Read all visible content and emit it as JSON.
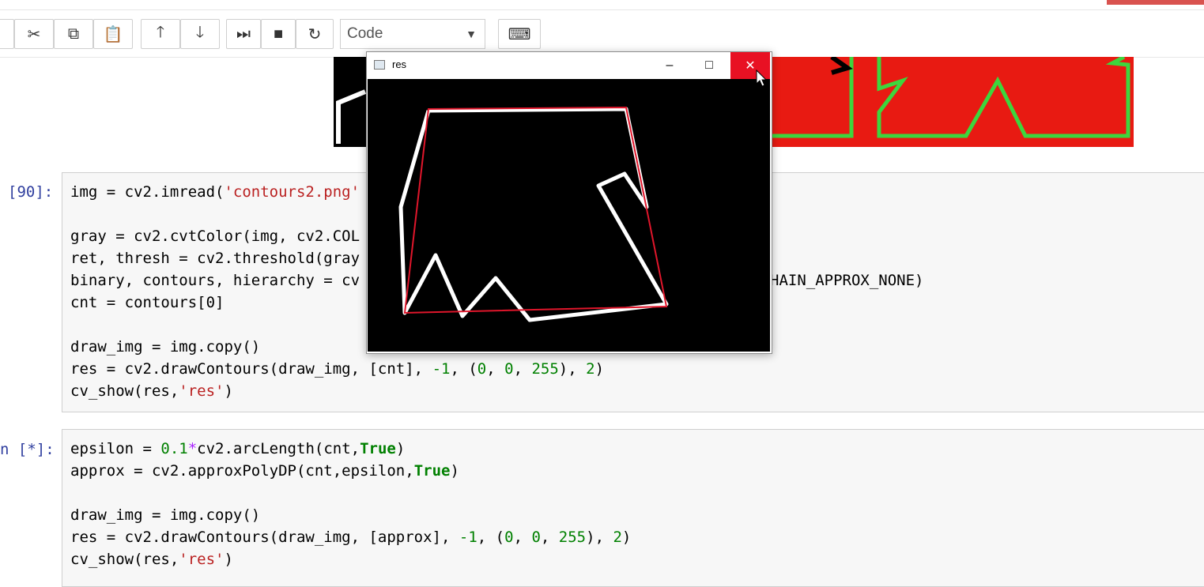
{
  "toolbar": {
    "buttons": [
      {
        "name": "cut-icon",
        "glyph": "✂"
      },
      {
        "name": "copy-icon",
        "glyph": "⧉"
      },
      {
        "name": "paste-icon",
        "glyph": "📋"
      },
      {
        "name": "move-up-icon",
        "glyph": "🡑"
      },
      {
        "name": "move-down-icon",
        "glyph": "🡓"
      },
      {
        "name": "run-icon",
        "glyph": "⏭"
      },
      {
        "name": "stop-icon",
        "glyph": "■"
      },
      {
        "name": "restart-icon",
        "glyph": "↻"
      },
      {
        "name": "keyboard-icon",
        "glyph": "⌨"
      }
    ],
    "cell_type": "Code"
  },
  "cells": [
    {
      "prompt": "[90]:"
    },
    {
      "prompt": "n [*]:"
    }
  ],
  "window": {
    "title": "res",
    "minimize": "–",
    "maximize": "□",
    "close": "✕"
  },
  "colors": {
    "contour_red": "#e0162b",
    "accent_close": "#e81123",
    "prompt": "#303f9f",
    "string": "#ba2121",
    "number": "#008000"
  },
  "code": {
    "c1_l1_a": "img = cv2.imread(",
    "c1_l1_s": "'contours2.png'",
    "c1_l2": "gray = cv2.cvtColor(img, cv2.COL",
    "c1_l3": "ret, thresh = cv2.threshold(gray",
    "c1_l4_a": "binary, contours, hierarchy = cv",
    "c1_l4_b": "HAIN_APPROX_NONE)",
    "c1_l5": "cnt = contours[0]",
    "c1_l6": "draw_img = img.copy()",
    "c1_l7_a": "res = cv2.drawContours(draw_img, [cnt], ",
    "c1_l7_b": "-1",
    "c1_l7_c": ", (",
    "c1_l7_d": "0",
    "c1_l7_e": ", ",
    "c1_l7_f": "0",
    "c1_l7_g": ", ",
    "c1_l7_h": "255",
    "c1_l7_i": "), ",
    "c1_l7_j": "2",
    "c1_l7_k": ")",
    "c1_l8_a": "cv_show(res,",
    "c1_l8_s": "'res'",
    "c1_l8_b": ")",
    "c2_l1_a": "epsilon = ",
    "c2_l1_n": "0.1",
    "c2_l1_o": "*",
    "c2_l1_b": "cv2.arcLength(cnt,",
    "c2_l1_k": "True",
    "c2_l1_c": ")",
    "c2_l2_a": "approx = cv2.approxPolyDP(cnt,epsilon,",
    "c2_l2_k": "True",
    "c2_l2_c": ")",
    "c2_l3": "draw_img = img.copy()",
    "c2_l4_a": "res = cv2.drawContours(draw_img, [approx], ",
    "c2_l4_b": "-1",
    "c2_l4_c": ", (",
    "c2_l4_d": "0",
    "c2_l4_e": ", ",
    "c2_l4_f": "0",
    "c2_l4_g": ", ",
    "c2_l4_h": "255",
    "c2_l4_i": "), ",
    "c2_l4_j": "2",
    "c2_l4_k": ")",
    "c2_l5_a": "cv_show(res,",
    "c2_l5_s": "'res'",
    "c2_l5_b": ")"
  }
}
